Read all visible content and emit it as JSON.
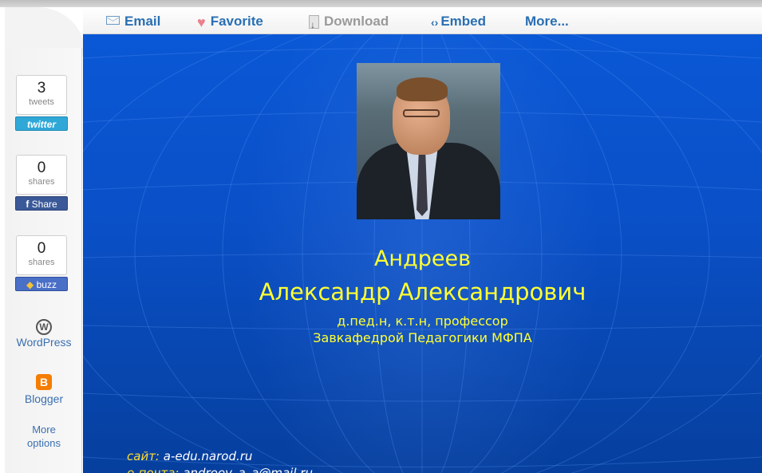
{
  "toolbar": {
    "email": "Email",
    "favorite": "Favorite",
    "download": "Download",
    "embed": "Embed",
    "more": "More..."
  },
  "share": {
    "twitter": {
      "count": "3",
      "unit": "tweets",
      "button": "twitter"
    },
    "facebook": {
      "count": "0",
      "unit": "shares",
      "button": "Share"
    },
    "buzz": {
      "count": "0",
      "unit": "shares",
      "button": "buzz"
    },
    "wordpress": "WordPress",
    "blogger": "Blogger",
    "more_line1": "More",
    "more_line2": "options"
  },
  "slide": {
    "name_line1": "Андреев",
    "name_line2": "Александр Александрович",
    "degree": "д.пед.н, к.т.н, профессор",
    "position": "Завкафедрой Педагогики МФПА",
    "site_label": "сайт:",
    "site_value": "a-edu.narod.ru",
    "email_label": "е-почта:",
    "email_value": "andreev_a_a@mail.ru"
  },
  "colors": {
    "slide_bg": "#0a50c8",
    "title_text": "#ffff33",
    "toolbar_link": "#2a6fb3"
  }
}
